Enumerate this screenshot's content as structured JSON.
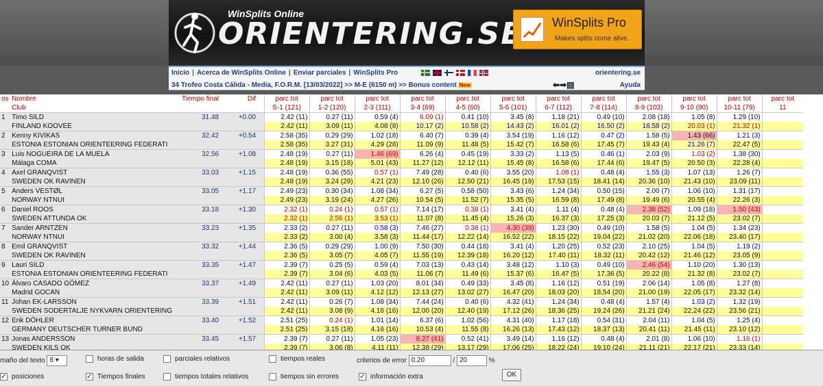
{
  "banner": {
    "subtitle": "WinSplits Online",
    "logo": "ORIENTERING.SE",
    "pro_title": "WinSplits Pro",
    "pro_tagline": "Makes splits come alive."
  },
  "nav": {
    "links": [
      "Inicio",
      "Acerca de WinSplits Online",
      "Enviar parciales",
      "WinSplits Pro"
    ],
    "site": "orientering.se",
    "breadcrumb": "34 Trofeo Costa Cálida - Media, F.O.R.M. [13/03/2022] >> M-E (6150 m) >> Bonus content",
    "new_badge": "New",
    "help": "Ayuda"
  },
  "table_header": {
    "pos_top": "os",
    "name": "Nombre",
    "club": "Club",
    "final_time": "Tiempo final",
    "diff": "Dif",
    "parc_tot": "parc tot",
    "legs": [
      "S-1 (121)",
      "1-2 (120)",
      "2-3 (111)",
      "3-4 (69)",
      "4-5 (60)",
      "5-6 (101)",
      "6-7 (112)",
      "7-8 (114)",
      "8-9 (103)",
      "9-10 (90)",
      "10-11 (79)",
      "11"
    ]
  },
  "runners": [
    {
      "pos": "1",
      "name": "Timo SILD",
      "club": "FINLAND KOOVEE",
      "time": "31.48",
      "diff": "+0.00",
      "split": [
        "2.42 (11)",
        "0.27 (11)",
        "0.59 (4)",
        "6.09 (1)",
        "0.41 (10)",
        "3.45 (8)",
        "1.18 (21)",
        "0.49 (10)",
        "2.08 (18)",
        "1.05 (8)",
        "1.29 (10)",
        ""
      ],
      "total": [
        "2.42 (11)",
        "3.09 (11)",
        "4.08 (8)",
        "10.17 (2)",
        "10.58 (2)",
        "14.43 (2)",
        "16.01 (2)",
        "16.50 (2)",
        "18.58 (2)",
        "20.03 (1)",
        "21.32 (1)",
        ""
      ]
    },
    {
      "pos": "2",
      "name": "Kenny KIVIKAS",
      "club": "ESTONIA ESTONIAN ORIENTEERING FEDERATI",
      "time": "32.42",
      "diff": "+0.54",
      "split": [
        "2.58 (35)",
        "0.29 (29)",
        "1.02 (18)",
        "6.40 (7)",
        "0.39 (4)",
        "3.54 (19)",
        "1.16 (12)",
        "0.47 (2)",
        "1.58 (5)",
        "1.43 (66)",
        "1.21 (3)",
        ""
      ],
      "total": [
        "2.58 (35)",
        "3.27 (31)",
        "4.29 (28)",
        "11.09 (9)",
        "11.48 (5)",
        "15.42 (7)",
        "16.58 (6)",
        "17.45 (7)",
        "19.43 (4)",
        "21.26 (7)",
        "22.47 (5)",
        ""
      ]
    },
    {
      "pos": "3",
      "name": "Luis NOGUEIRA DE LA MUELA",
      "club": "Málaga COMA",
      "time": "32.56",
      "diff": "+1.08",
      "split": [
        "2.48 (19)",
        "0.27 (11)",
        "1.46 (69)",
        "6.26 (4)",
        "0.45 (19)",
        "3.33 (2)",
        "1.13 (5)",
        "0.46 (1)",
        "2.03 (9)",
        "1.03 (2)",
        "1.38 (30)",
        ""
      ],
      "total": [
        "2.48 (19)",
        "3.15 (18)",
        "5.01 (43)",
        "11.27 (12)",
        "12.12 (11)",
        "15.45 (8)",
        "16.58 (6)",
        "17.44 (6)",
        "19.47 (5)",
        "20.50 (3)",
        "22.28 (4)",
        ""
      ]
    },
    {
      "pos": "4",
      "name": "Axel GRANQVIST",
      "club": "SWEDEN OK RAVINEN",
      "time": "33.03",
      "diff": "+1.15",
      "split": [
        "2.48 (19)",
        "0.36 (55)",
        "0.57 (1)",
        "7.49 (28)",
        "0.40 (6)",
        "3.55 (20)",
        "1.08 (1)",
        "0.48 (4)",
        "1.55 (3)",
        "1.07 (13)",
        "1.26 (7)",
        ""
      ],
      "total": [
        "2.48 (19)",
        "3.24 (29)",
        "4.21 (23)",
        "12.10 (26)",
        "12.50 (21)",
        "16.45 (19)",
        "17.53 (15)",
        "18.41 (14)",
        "20.36 (10)",
        "21.43 (10)",
        "23.09 (11)",
        ""
      ]
    },
    {
      "pos": "5",
      "name": "Anders VESTØL",
      "club": "NORWAY NTNUI",
      "time": "33.05",
      "diff": "+1.17",
      "split": [
        "2.49 (23)",
        "0.30 (34)",
        "1.08 (34)",
        "6.27 (5)",
        "0.58 (50)",
        "3.43 (6)",
        "1.24 (34)",
        "0.50 (15)",
        "2.00 (7)",
        "1.06 (10)",
        "1.31 (17)",
        ""
      ],
      "total": [
        "2.49 (23)",
        "3.19 (24)",
        "4.27 (26)",
        "10.54 (5)",
        "11.52 (7)",
        "15.35 (5)",
        "16.59 (8)",
        "17.49 (8)",
        "19.49 (6)",
        "20.55 (4)",
        "22.26 (3)",
        ""
      ]
    },
    {
      "pos": "6",
      "name": "Daniel ROOS",
      "club": "SWEDEN ATTUNDA OK",
      "time": "33.18",
      "diff": "+1.30",
      "split": [
        "2.32 (1)",
        "0.24 (1)",
        "0.57 (1)",
        "7.14 (17)",
        "0.38 (1)",
        "3.41 (4)",
        "1.11 (4)",
        "0.48 (4)",
        "2.38 (52)",
        "1.09 (18)",
        "1.50 (43)",
        ""
      ],
      "total": [
        "2.32 (1)",
        "2.56 (1)",
        "3.53 (1)",
        "11.07 (8)",
        "11.45 (4)",
        "15.26 (3)",
        "16.37 (3)",
        "17.25 (3)",
        "20.03 (7)",
        "21.12 (5)",
        "23.02 (7)",
        ""
      ]
    },
    {
      "pos": "7",
      "name": "Sander ARNTZEN",
      "club": "NORWAY NTNUI",
      "time": "33.23",
      "diff": "+1.35",
      "split": [
        "2.33 (2)",
        "0.27 (11)",
        "0.58 (3)",
        "7.46 (27)",
        "0.38 (1)",
        "4.30 (39)",
        "1.23 (30)",
        "0.49 (10)",
        "1.58 (5)",
        "1.04 (5)",
        "1.34 (23)",
        ""
      ],
      "total": [
        "2.33 (2)",
        "3.00 (4)",
        "3.58 (3)",
        "11.44 (17)",
        "12.22 (14)",
        "16.52 (22)",
        "18.15 (22)",
        "19.04 (22)",
        "21.02 (20)",
        "22.06 (18)",
        "23.40 (17)",
        ""
      ]
    },
    {
      "pos": "8",
      "name": "Emil GRANQVIST",
      "club": "SWEDEN OK RAVINEN",
      "time": "33.32",
      "diff": "+1.44",
      "split": [
        "2.36 (5)",
        "0.29 (29)",
        "1.00 (9)",
        "7.50 (30)",
        "0.44 (18)",
        "3.41 (4)",
        "1.20 (25)",
        "0.52 (23)",
        "2.10 (25)",
        "1.04 (5)",
        "1.19 (2)",
        ""
      ],
      "total": [
        "2.36 (5)",
        "3.05 (7)",
        "4.05 (7)",
        "11.55 (19)",
        "12.39 (18)",
        "16.20 (12)",
        "17.40 (11)",
        "18.32 (11)",
        "20.42 (12)",
        "21.46 (12)",
        "23.05 (9)",
        ""
      ]
    },
    {
      "pos": "9",
      "name": "Lauri SILD",
      "club": "ESTONIA ESTONIAN ORIENTEERING FEDERATI",
      "time": "33.35",
      "diff": "+1.47",
      "split": [
        "2.39 (7)",
        "0.25 (5)",
        "0.59 (4)",
        "7.03 (13)",
        "0.43 (14)",
        "3.48 (12)",
        "1.10 (3)",
        "0.49 (10)",
        "2.46 (54)",
        "1.10 (20)",
        "1.30 (13)",
        ""
      ],
      "total": [
        "2.39 (7)",
        "3.04 (6)",
        "4.03 (5)",
        "11.06 (7)",
        "11.49 (6)",
        "15.37 (6)",
        "16.47 (5)",
        "17.36 (5)",
        "20.22 (8)",
        "21.32 (8)",
        "23.02 (7)",
        ""
      ]
    },
    {
      "pos": "10",
      "name": "Álvaro CASADO GÓMEZ",
      "club": "Madrid GOCAN",
      "time": "33.37",
      "diff": "+1.49",
      "split": [
        "2.42 (11)",
        "0.27 (11)",
        "1.03 (20)",
        "8.01 (34)",
        "0.49 (33)",
        "3.45 (8)",
        "1.16 (12)",
        "0.51 (19)",
        "2.06 (14)",
        "1.05 (8)",
        "1.27 (8)",
        ""
      ],
      "total": [
        "2.42 (11)",
        "3.09 (11)",
        "4.12 (12)",
        "12.13 (27)",
        "13.02 (27)",
        "16.47 (20)",
        "18.03 (20)",
        "18.54 (20)",
        "21.00 (19)",
        "22.05 (17)",
        "23.32 (14)",
        ""
      ]
    },
    {
      "pos": "11",
      "name": "Johan EK-LARSSON",
      "club": "SWEDEN SODERTALJE NYKVARN ORIENTERING",
      "time": "33.39",
      "diff": "+1.51",
      "split": [
        "2.42 (11)",
        "0.26 (7)",
        "1.08 (34)",
        "7.44 (24)",
        "0.40 (6)",
        "4.32 (41)",
        "1.24 (34)",
        "0.48 (4)",
        "1.57 (4)",
        "1.03 (2)",
        "1.32 (19)",
        ""
      ],
      "total": [
        "2.42 (11)",
        "3.08 (9)",
        "4.16 (16)",
        "12.00 (20)",
        "12.40 (19)",
        "17.12 (26)",
        "18.36 (25)",
        "19.24 (26)",
        "21.21 (24)",
        "22.24 (22)",
        "23.56 (21)",
        ""
      ]
    },
    {
      "pos": "12",
      "name": "Erik DÖHLER",
      "club": "GERMANY DEUTSCHER TURNER BUND",
      "time": "33.40",
      "diff": "+1.52",
      "split": [
        "2.51 (25)",
        "0.24 (1)",
        "1.01 (14)",
        "6.37 (6)",
        "1.02 (56)",
        "4.31 (40)",
        "1.17 (18)",
        "0.54 (31)",
        "2.04 (11)",
        "1.04 (5)",
        "1.25 (4)",
        ""
      ],
      "total": [
        "2.51 (25)",
        "3.15 (18)",
        "4.16 (16)",
        "10.53 (4)",
        "11.55 (8)",
        "16.26 (13)",
        "17.43 (12)",
        "18.37 (13)",
        "20.41 (11)",
        "21.45 (11)",
        "23.10 (12)",
        ""
      ]
    },
    {
      "pos": "13",
      "name": "Jonas ANDERSSON",
      "club": "SWEDEN KILS OK",
      "time": "33.45",
      "diff": "+1.57",
      "split": [
        "2.39 (7)",
        "0.27 (11)",
        "1.05 (23)",
        "8.27 (41)",
        "0.52 (41)",
        "3.49 (14)",
        "1.16 (12)",
        "0.48 (4)",
        "2.01 (8)",
        "1.06 (10)",
        "1.16 (1)",
        ""
      ],
      "total": [
        "2.39 (7)",
        "3.06 (8)",
        "4.11 (11)",
        "12.38 (29)",
        "13.17 (29)",
        "17.06 (25)",
        "18.22 (24)",
        "19.10 (24)",
        "21.11 (21)",
        "22.17 (21)",
        "23.33 (14)",
        ""
      ]
    }
  ],
  "footer": {
    "text_size_label": "maño del texto",
    "text_size_value": "8",
    "positions": "posiciones",
    "start_hours": "horas de salida",
    "final_times": "Tiempos finales",
    "relative_splits": "parciales relativos",
    "relative_totals": "tiempos totales relativos",
    "real_times": "tiempos reales",
    "no_error_times": "tiempos sin errores",
    "error_criteria": "criterios de error",
    "error_value": "0.20",
    "error_slash": "/",
    "error_pct": "20",
    "pct_sign": "%",
    "extra_info": "información extra",
    "ok": "OK"
  },
  "colors": {
    "accent_pro": "#f2a419",
    "highlight_bg": "#ffff99",
    "bad_bg": "#f8b3b3",
    "header_red": "#aa0000",
    "link_blue": "#1f3f86"
  }
}
